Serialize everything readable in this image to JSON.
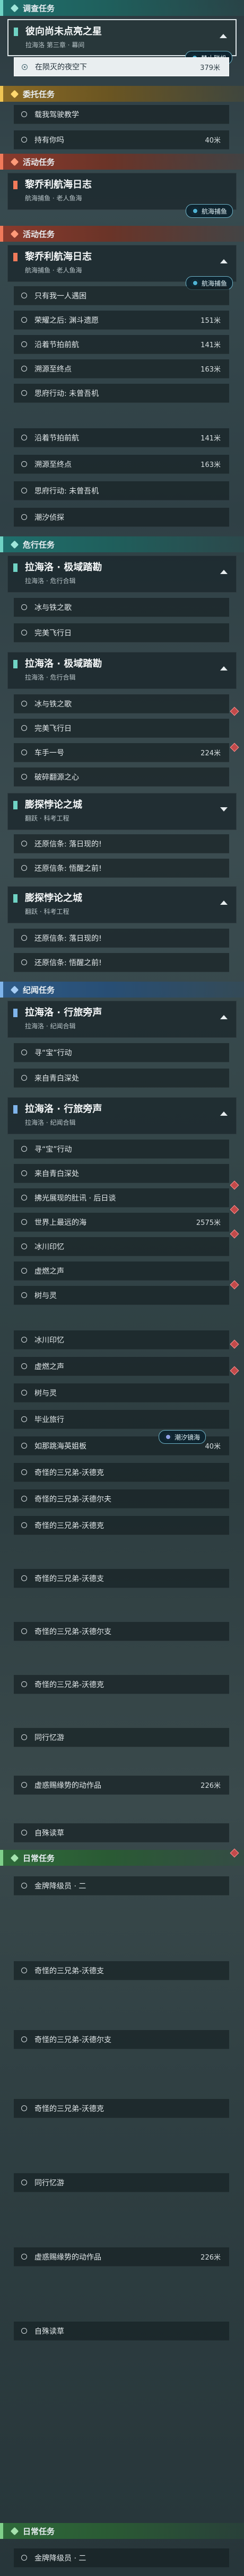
{
  "sections": {
    "s0": {
      "label": "调查任务"
    },
    "s1": {
      "label": "委托任务"
    },
    "s2": {
      "label": "活动任务"
    },
    "s3": {
      "label": "活动任务"
    },
    "s4": {
      "label": "危行任务"
    },
    "s5": {
      "label": "纪闻任务"
    },
    "s6": {
      "label": "日常任务"
    },
    "s7": {
      "label": "日常任务"
    }
  },
  "cards": {
    "c0": {
      "title": "彼向尚未点亮之星",
      "subtitle": "拉海洛 第三章 · 幕间"
    },
    "c1": {
      "title": "黎乔利航海日志",
      "subtitle": "航海捕鱼 · 老人鱼海"
    },
    "c2": {
      "title": "黎乔利航海日志",
      "subtitle": "航海捕鱼 · 老人鱼海"
    },
    "c3": {
      "title": "拉海洛 · 极域踏勘",
      "subtitle": "拉海洛 · 危行合辑"
    },
    "c4": {
      "title": "拉海洛 · 极域踏勘",
      "subtitle": "拉海洛 · 危行合辑"
    },
    "c5": {
      "title": "膨探悖论之城",
      "subtitle": "翻跃 · 科考工程"
    },
    "c6": {
      "title": "膨探悖论之城",
      "subtitle": "翻跃 · 科考工程"
    },
    "c7": {
      "title": "拉海洛 · 行旅旁声",
      "subtitle": "拉海洛 · 纪闻合辑"
    },
    "c8": {
      "title": "拉海洛 · 行旅旁声",
      "subtitle": "拉海洛 · 纪闻合辑"
    }
  },
  "tags": {
    "t0": {
      "label": "禁止联机"
    },
    "t1": {
      "label": "航海捕鱼"
    },
    "t2": {
      "label": "航海捕鱼"
    },
    "t3": {
      "label": "潮汐镜海"
    }
  },
  "rows": {
    "r0": {
      "text": "在陨灭的夜空下",
      "dist": "379米"
    },
    "r1": {
      "text": "载我驾驶教学",
      "dist": ""
    },
    "r2": {
      "text": "持有你吗",
      "dist": "40米"
    },
    "r3": {
      "text": "只有我一人遇困",
      "dist": ""
    },
    "r4": {
      "text": "荣耀之后: 渊斗遗愿",
      "dist": "151米"
    },
    "r5": {
      "text": "沿着节拍前航",
      "dist": "141米"
    },
    "r6": {
      "text": "溯源至终点",
      "dist": "163米"
    },
    "r7": {
      "text": "思府行动: 未曾吾机",
      "dist": ""
    },
    "r8": {
      "text": "沿着节拍前航",
      "dist": "141米"
    },
    "r9": {
      "text": "溯源至终点",
      "dist": "163米"
    },
    "r10": {
      "text": "思府行动: 未曾吾机",
      "dist": ""
    },
    "r11": {
      "text": "潮汐侦探",
      "dist": ""
    },
    "r12": {
      "text": "冰与铁之歌",
      "dist": ""
    },
    "r13": {
      "text": "完美飞行日",
      "dist": ""
    },
    "r14": {
      "text": "冰与铁之歌",
      "dist": ""
    },
    "r15": {
      "text": "完美飞行日",
      "dist": ""
    },
    "r16": {
      "text": "车手一号",
      "dist": "224米"
    },
    "r17": {
      "text": "破碎翻源之心",
      "dist": ""
    },
    "r18": {
      "text": "还原信条: 落日现的!",
      "dist": ""
    },
    "r19": {
      "text": "还原信条: 悟醒之前!",
      "dist": ""
    },
    "r20": {
      "text": "还原信条: 落日现的!",
      "dist": ""
    },
    "r21": {
      "text": "还原信条: 悟醒之前!",
      "dist": ""
    },
    "r22": {
      "text": "寻“宝”行动",
      "dist": ""
    },
    "r23": {
      "text": "来自青白深处",
      "dist": ""
    },
    "r24": {
      "text": "寻“宝”行动",
      "dist": ""
    },
    "r25": {
      "text": "来自青白深处",
      "dist": ""
    },
    "r26": {
      "text": "拂光展现的肚讯 · 后日谈",
      "dist": ""
    },
    "r27": {
      "text": "世界上最远的海",
      "dist": "2575米"
    },
    "r28": {
      "text": "冰川印忆",
      "dist": ""
    },
    "r29": {
      "text": "虚燃之声",
      "dist": ""
    },
    "r30": {
      "text": "树与灵",
      "dist": ""
    },
    "r31": {
      "text": "冰川印忆",
      "dist": ""
    },
    "r32": {
      "text": "虚燃之声",
      "dist": ""
    },
    "r33": {
      "text": "树与灵",
      "dist": ""
    },
    "r34": {
      "text": "毕业旅行",
      "dist": ""
    },
    "r35": {
      "text": "如那跳海英姐板",
      "dist": "40米"
    },
    "r36": {
      "text": "奇怪的三兄弟-沃德克",
      "dist": ""
    },
    "r37": {
      "text": "奇怪的三兄弟-沃德尔夫",
      "dist": ""
    },
    "r38": {
      "text": "奇怪的三兄弟-沃德克",
      "dist": ""
    },
    "r39": {
      "text": "奇怪的三兄弟-沃德支",
      "dist": ""
    },
    "r40": {
      "text": "奇怪的三兄弟-沃德尔支",
      "dist": ""
    },
    "r41": {
      "text": "奇怪的三兄弟-沃德克",
      "dist": ""
    },
    "r42": {
      "text": "同行忆游",
      "dist": ""
    },
    "r43": {
      "text": "虚惑赐缘势的动作品",
      "dist": "226米"
    },
    "r44": {
      "text": "自殊读草",
      "dist": ""
    },
    "r45": {
      "text": "金牌降级员 · 二",
      "dist": ""
    },
    "r46": {
      "text": "奇怪的三兄弟-沃德支",
      "dist": ""
    },
    "r47": {
      "text": "奇怪的三兄弟-沃德尔支",
      "dist": ""
    },
    "r48": {
      "text": "奇怪的三兄弟-沃德克",
      "dist": ""
    },
    "r49": {
      "text": "同行忆游",
      "dist": ""
    },
    "r50": {
      "text": "虚惑赐缘势的动作品",
      "dist": "226米"
    },
    "r51": {
      "text": "自殊读草",
      "dist": ""
    },
    "r52": {
      "text": "金牌降级员 · 二",
      "dist": ""
    }
  },
  "colors": {
    "teal": "#1f6f6c",
    "gold": "#8a6a25",
    "red": "#8a3a2c",
    "blue": "#2e5a86",
    "green": "#2f6a3a"
  }
}
